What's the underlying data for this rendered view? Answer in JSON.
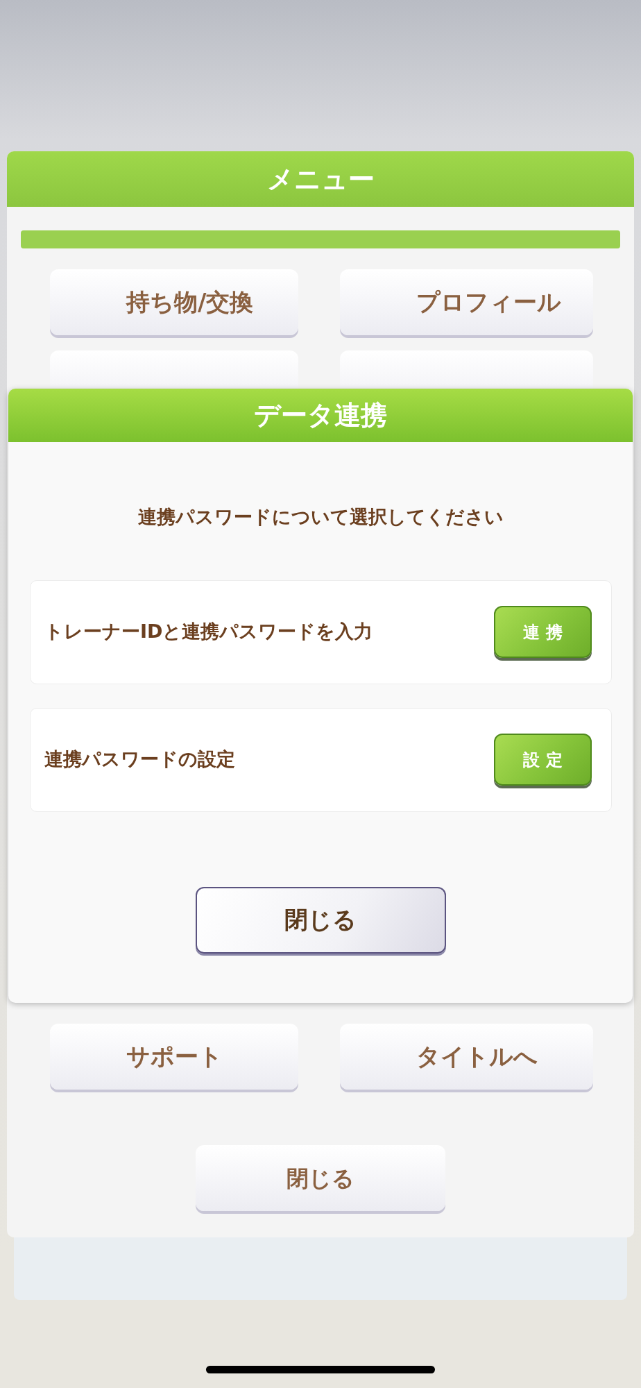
{
  "background_menu": {
    "title": "メニュー",
    "buttons": [
      {
        "label": "持ち物/交換"
      },
      {
        "label": "プロフィール"
      },
      {
        "label": "サポート"
      },
      {
        "label": "タイトルへ"
      }
    ],
    "close_button": "閉じる"
  },
  "dialog": {
    "title": "データ連携",
    "message": "連携パスワードについて選択してください",
    "options": [
      {
        "label": "トレーナーIDと連携パスワードを入力",
        "button": "連 携"
      },
      {
        "label": "連携パスワードの設定",
        "button": "設 定"
      }
    ],
    "close_button": "閉じる"
  }
}
